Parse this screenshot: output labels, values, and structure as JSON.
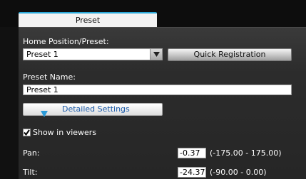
{
  "tab": {
    "label": "Preset"
  },
  "home_preset": {
    "label": "Home Position/Preset:",
    "selected": "Preset 1",
    "quick_registration_label": "Quick Registration"
  },
  "preset_name": {
    "label": "Preset Name:",
    "value": "Preset 1"
  },
  "detailed_settings": {
    "label": "Detailed Settings"
  },
  "show_in_viewers": {
    "label": "Show in viewers",
    "checked": true
  },
  "pan": {
    "label": "Pan:",
    "value": "-0.37",
    "range": "(-175.00 - 175.00)"
  },
  "tilt": {
    "label": "Tilt:",
    "value": "-24.37",
    "range": "(-90.00 - 0.00)"
  },
  "colors": {
    "tab_accent": "#2aa8d8",
    "detail_text": "#1a5aa8"
  },
  "icons": {
    "dropdown": "chevron-down-icon",
    "detailed_settings": "triangle-down-icon",
    "checkbox": "checkmark-icon"
  }
}
